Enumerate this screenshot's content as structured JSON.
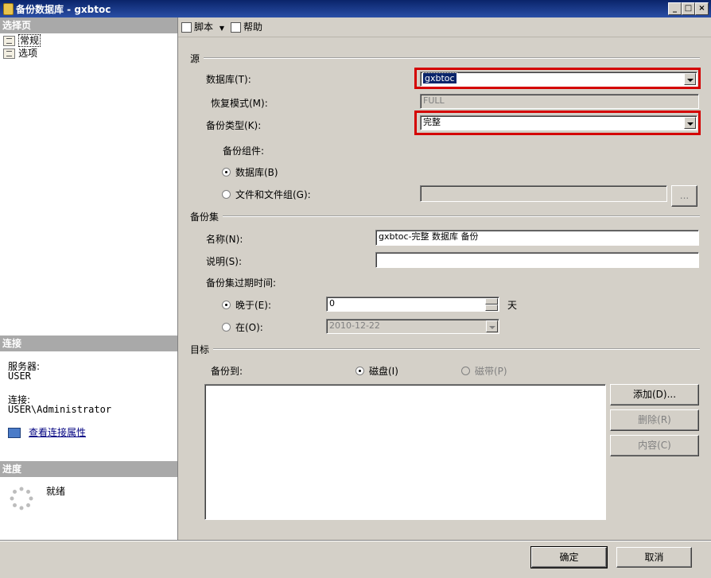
{
  "window": {
    "title": "备份数据库 - gxbtoc",
    "minimize": "_",
    "maximize": "□",
    "close": "×"
  },
  "left": {
    "select_page_header": "选择页",
    "nav_items": [
      "常规",
      "选项"
    ],
    "connection_header": "连接",
    "server_label": "服务器:",
    "server_value": "USER",
    "connection_label": "连接:",
    "connection_value": "USER\\Administrator",
    "view_connection_link": "查看连接属性",
    "progress_header": "进度",
    "progress_status": "就绪"
  },
  "toolbar": {
    "script_label": "脚本",
    "help_label": "帮助"
  },
  "source": {
    "group_label": "源",
    "database_label": "数据库(T):",
    "database_value": "gxbtoc",
    "recovery_label": "恢复模式(M):",
    "recovery_value": "FULL",
    "backup_type_label": "备份类型(K):",
    "backup_type_value": "完整",
    "component_label": "备份组件:",
    "radio_database": "数据库(B)",
    "radio_files": "文件和文件组(G):",
    "browse_label": "..."
  },
  "backup_set": {
    "group_label": "备份集",
    "name_label": "名称(N):",
    "name_value": "gxbtoc-完整 数据库 备份",
    "desc_label": "说明(S):",
    "desc_value": "",
    "expire_label": "备份集过期时间:",
    "after_label": "晚于(E):",
    "after_value": "0",
    "days_label": "天",
    "on_label": "在(O):",
    "on_value": "2010-12-22"
  },
  "destination": {
    "group_label": "目标",
    "backup_to_label": "备份到:",
    "disk_label": "磁盘(I)",
    "tape_label": "磁带(P)",
    "add_button": "添加(D)...",
    "remove_button": "删除(R)",
    "contents_button": "内容(C)"
  },
  "footer": {
    "ok_button": "确定",
    "cancel_button": "取消"
  }
}
